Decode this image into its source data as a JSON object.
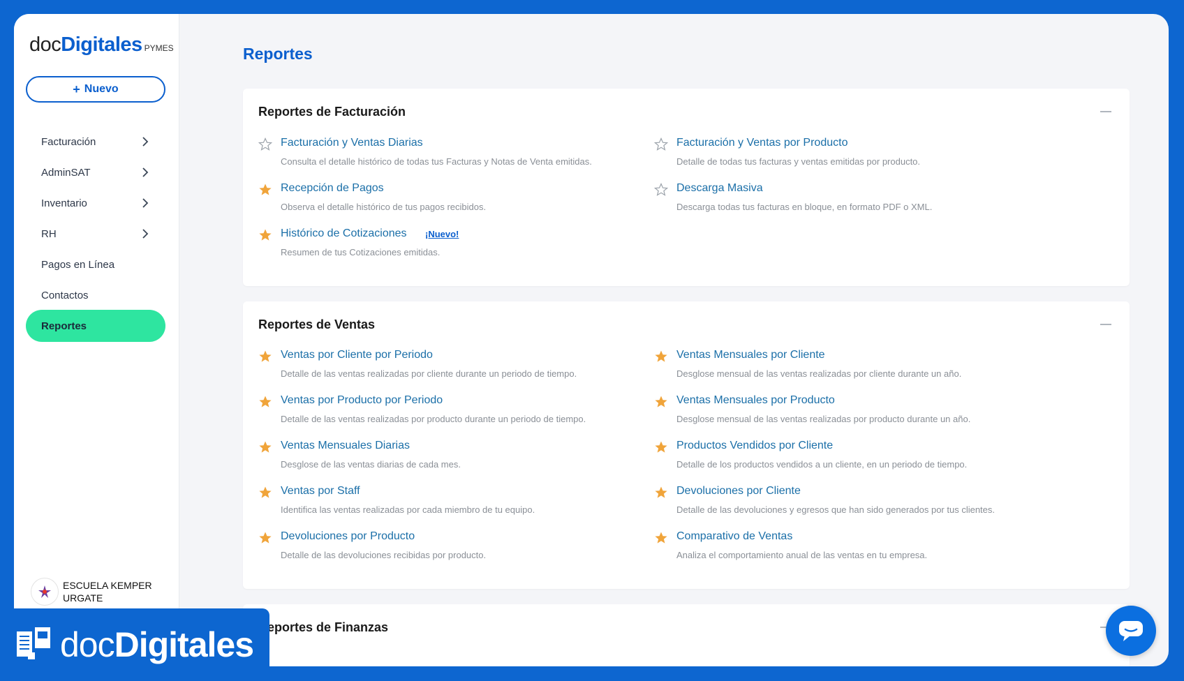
{
  "brand": {
    "doc": "doc",
    "digitales": "Digitales",
    "pymes": "PYMES"
  },
  "sidebar": {
    "new_button": "Nuevo",
    "items": [
      {
        "label": "Facturación",
        "has_chevron": true
      },
      {
        "label": "AdminSAT",
        "has_chevron": true
      },
      {
        "label": "Inventario",
        "has_chevron": true
      },
      {
        "label": "RH",
        "has_chevron": true
      },
      {
        "label": "Pagos en Línea",
        "has_chevron": false
      },
      {
        "label": "Contactos",
        "has_chevron": false
      },
      {
        "label": "Reportes",
        "has_chevron": false,
        "active": true
      }
    ],
    "org": {
      "line1": "ESCUELA KEMPER",
      "line2": "URGATE"
    }
  },
  "page": {
    "title": "Reportes"
  },
  "sections": [
    {
      "title": "Reportes de Facturación",
      "reports": [
        {
          "name": "Facturación y Ventas Diarias",
          "desc": "Consulta el detalle histórico de todas tus Facturas y Notas de Venta emitidas.",
          "favorite": false
        },
        {
          "name": "Facturación y Ventas por Producto",
          "desc": "Detalle de todas tus facturas y ventas emitidas por producto.",
          "favorite": false
        },
        {
          "name": "Recepción de Pagos",
          "desc": "Observa el detalle histórico de tus pagos recibidos.",
          "favorite": true
        },
        {
          "name": "Descarga Masiva",
          "desc": "Descarga todas tus facturas en bloque, en formato PDF o XML.",
          "favorite": false
        },
        {
          "name": "Histórico de Cotizaciones",
          "desc": "Resumen de tus Cotizaciones emitidas.",
          "favorite": true,
          "badge": "¡Nuevo!"
        }
      ]
    },
    {
      "title": "Reportes de Ventas",
      "reports": [
        {
          "name": "Ventas por Cliente por Periodo",
          "desc": "Detalle de las ventas realizadas por cliente durante un periodo de tiempo.",
          "favorite": true
        },
        {
          "name": "Ventas Mensuales por Cliente",
          "desc": "Desglose mensual de las ventas realizadas por cliente durante un año.",
          "favorite": true
        },
        {
          "name": "Ventas por Producto por Periodo",
          "desc": "Detalle de las ventas realizadas por producto durante un periodo de tiempo.",
          "favorite": true
        },
        {
          "name": "Ventas Mensuales por Producto",
          "desc": "Desglose mensual de las ventas realizadas por producto durante un año.",
          "favorite": true
        },
        {
          "name": "Ventas Mensuales Diarias",
          "desc": "Desglose de las ventas diarias de cada mes.",
          "favorite": true
        },
        {
          "name": "Productos Vendidos por Cliente",
          "desc": "Detalle de los productos vendidos a un cliente, en un periodo de tiempo.",
          "favorite": true
        },
        {
          "name": "Ventas por Staff",
          "desc": "Identifica las ventas realizadas por cada miembro de tu equipo.",
          "favorite": true
        },
        {
          "name": "Devoluciones por Cliente",
          "desc": "Detalle de las devoluciones y egresos que han sido generados por tus clientes.",
          "favorite": true
        },
        {
          "name": "Devoluciones por Producto",
          "desc": "Detalle de las devoluciones recibidas por producto.",
          "favorite": true
        },
        {
          "name": "Comparativo de Ventas",
          "desc": "Analiza el comportamiento anual de las ventas en tu empresa.",
          "favorite": true
        }
      ]
    },
    {
      "title": "Reportes de Finanzas",
      "visible_title": "rtes de Finanzas",
      "reports": []
    }
  ],
  "overlay": {
    "brand_doc": "doc",
    "brand_digitales": "Digitales"
  },
  "colors": {
    "accent": "#0b5fce",
    "active_nav": "#2ee5a0",
    "star": "#f0a43a",
    "link": "#1b6fa8"
  }
}
